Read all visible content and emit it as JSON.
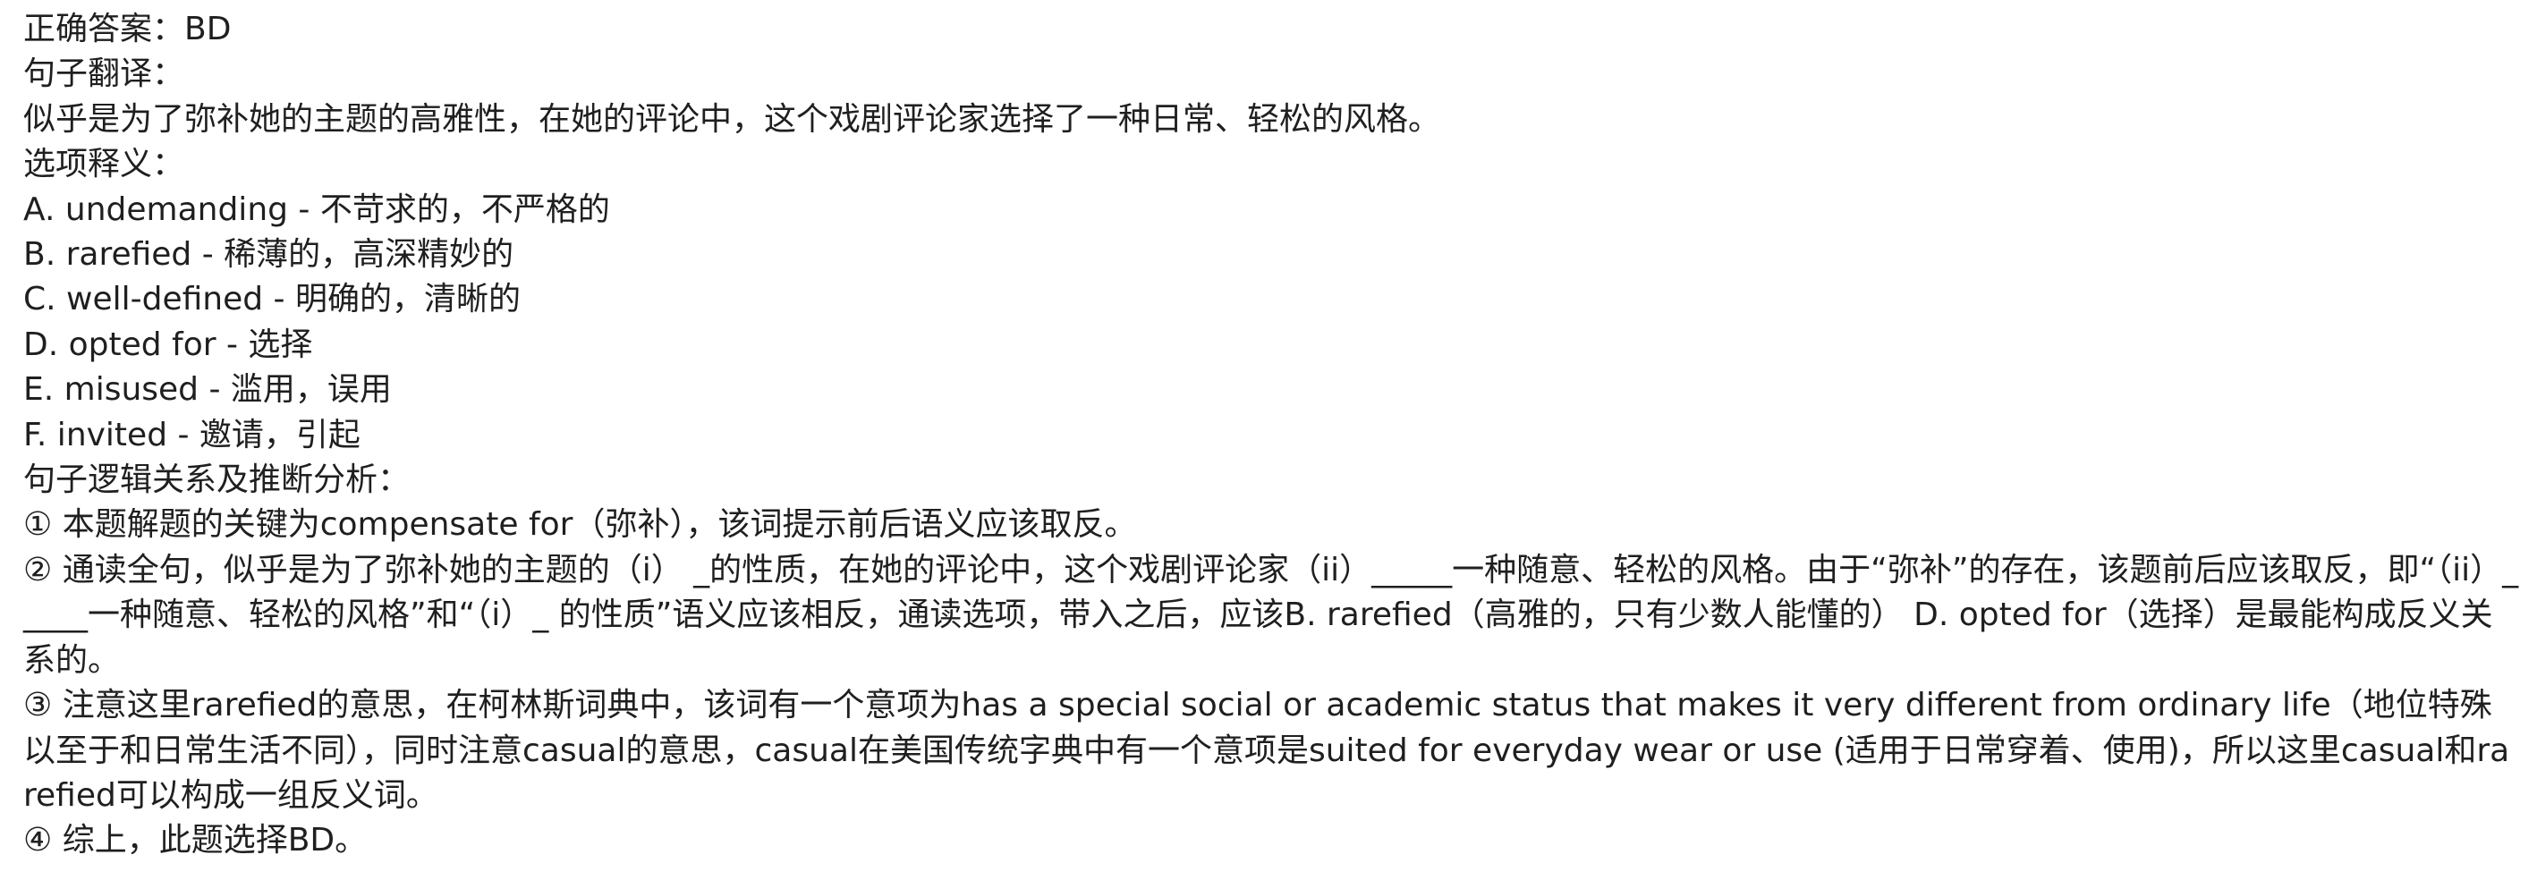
{
  "answer_label": "正确答案：",
  "answer_value": "BD",
  "translation_heading": "句子翻译：",
  "translation_text": "似乎是为了弥补她的主题的高雅性，在她的评论中，这个戏剧评论家选择了一种日常、轻松的风格。",
  "options_heading": "选项释义：",
  "options": [
    "A. undemanding - 不苛求的，不严格的",
    "B. rarefied - 稀薄的，高深精妙的",
    "C. well-defined - 明确的，清晰的",
    "D. opted for - 选择",
    "E. misused - 滥用，误用",
    "F. invited - 邀请，引起"
  ],
  "analysis_heading": "句子逻辑关系及推断分析：",
  "analysis": [
    "① 本题解题的关键为compensate for（弥补），该词提示前后语义应该取反。",
    "② 通读全句，似乎是为了弥补她的主题的（i） _的性质，在她的评论中，这个戏剧评论家（ii）_____一种随意、轻松的风格。由于“弥补”的存在，该题前后应该取反，即“（ii）_____一种随意、轻松的风格”和“（i）_ 的性质”语义应该相反，通读选项，带入之后，应该B. rarefied（高雅的，只有少数人能懂的） D. opted for（选择）是最能构成反义关系的。",
    "③ 注意这里rarefied的意思，在柯林斯词典中，该词有一个意项为has a special social or academic status that makes it very different from ordinary life（地位特殊以至于和日常生活不同），同时注意casual的意思，casual在美国传统字典中有一个意项是suited for everyday wear or use (适用于日常穿着、使用)，所以这里casual和rarefied可以构成一组反义词。",
    "④ 综上，此题选择BD。"
  ]
}
